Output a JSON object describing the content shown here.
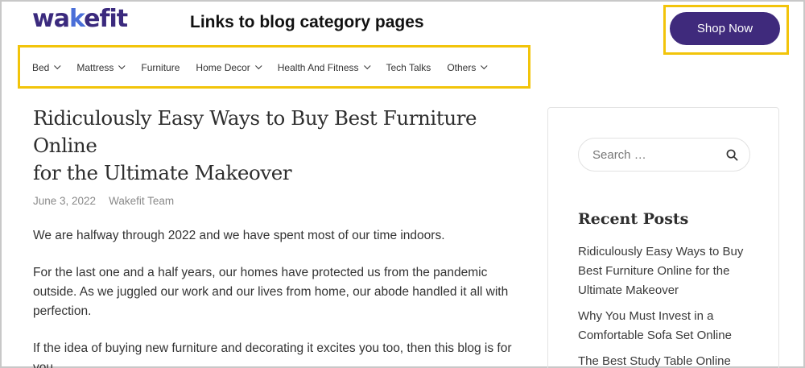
{
  "brand": {
    "logo_text_a": "wa",
    "logo_text_b": "k",
    "logo_text_c": "efit"
  },
  "annotation": {
    "title": "Links to blog category pages"
  },
  "header": {
    "shop_label": "Shop Now"
  },
  "nav": {
    "items": [
      {
        "label": "Bed",
        "has_dropdown": true
      },
      {
        "label": "Mattress",
        "has_dropdown": true
      },
      {
        "label": "Furniture",
        "has_dropdown": false
      },
      {
        "label": "Home Decor",
        "has_dropdown": true
      },
      {
        "label": "Health And Fitness",
        "has_dropdown": true
      },
      {
        "label": "Tech Talks",
        "has_dropdown": false
      },
      {
        "label": "Others",
        "has_dropdown": true
      }
    ]
  },
  "article": {
    "title_line1": "Ridiculously Easy Ways to Buy Best Furniture Online",
    "title_line2": "for the Ultimate Makeover",
    "date": "June 3, 2022",
    "author": "Wakefit Team",
    "paragraphs": [
      "We are halfway through 2022 and we have spent most of our time indoors.",
      "For the last one and a half years, our homes have protected us from the pandemic outside. As we juggled our work and our lives from home, our abode handled it all with perfection.",
      "If the idea of buying new furniture and decorating it excites you too, then this blog is for you."
    ]
  },
  "sidebar": {
    "search_placeholder": "Search …",
    "recent_heading": "Recent Posts",
    "recent_posts": [
      "Ridiculously Easy Ways to Buy Best Furniture Online for the Ultimate Makeover",
      "Why You Must Invest in a Comfortable Sofa Set Online",
      "The Best Study Table Online"
    ]
  },
  "colors": {
    "brand": "#3f2a7c",
    "highlight": "#f2c40a"
  }
}
